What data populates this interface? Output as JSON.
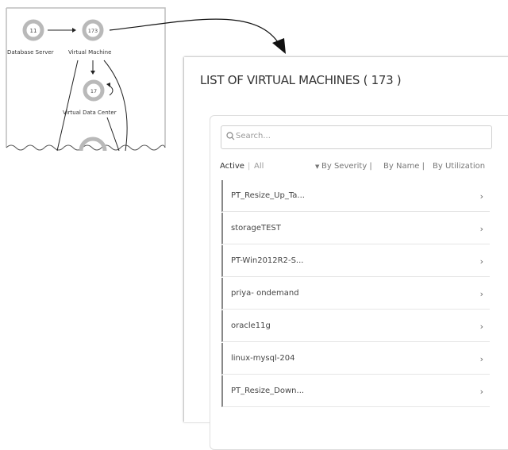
{
  "chain": {
    "nodes": [
      {
        "count": "11",
        "label": "Database Server"
      },
      {
        "count": "173",
        "label": "Virtual Machine"
      },
      {
        "count": "17",
        "label": "Virtual Data Center"
      }
    ]
  },
  "panel": {
    "title": "LIST OF VIRTUAL MACHINES ( 173 )",
    "search_placeholder": "Search...",
    "filters": {
      "active": "Active",
      "separator": "|",
      "all": "All",
      "by_severity": "By Severity |",
      "by_name": "By Name |",
      "by_utilization": "By Utilization"
    },
    "items": [
      {
        "label": "PT_Resize_Up_Ta..."
      },
      {
        "label": "storageTEST"
      },
      {
        "label": "PT-Win2012R2-S..."
      },
      {
        "label": "priya- ondemand"
      },
      {
        "label": "oracle11g"
      },
      {
        "label": "linux-mysql-204"
      },
      {
        "label": "PT_Resize_Down..."
      }
    ]
  },
  "colors": {
    "ring": "#b9b9b9",
    "row_marker": "#888888",
    "line": "#222222"
  }
}
